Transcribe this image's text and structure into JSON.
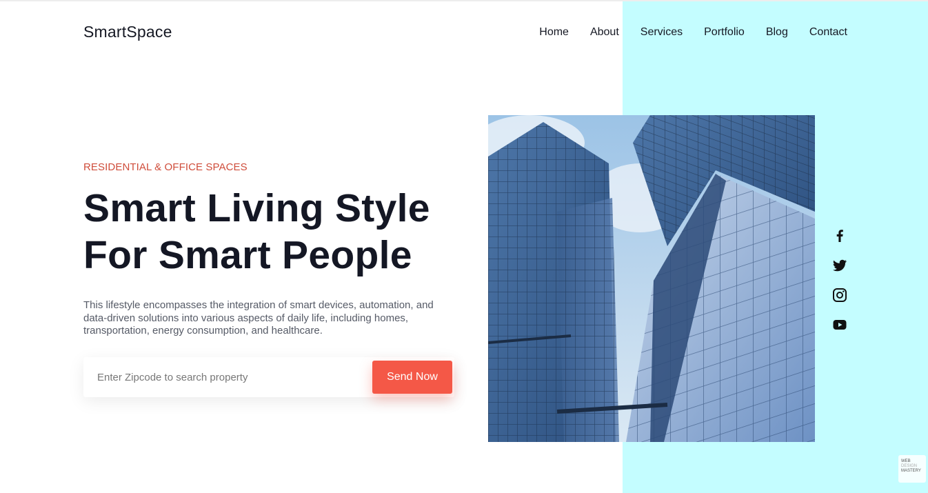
{
  "brand": {
    "name": "SmartSpace"
  },
  "nav": {
    "items": [
      "Home",
      "About",
      "Services",
      "Portfolio",
      "Blog",
      "Contact"
    ]
  },
  "hero": {
    "eyebrow": "RESIDENTIAL & OFFICE SPACES",
    "headline_line1": "Smart Living Style",
    "headline_line2": "For Smart People",
    "description": "This lifestyle encompasses the integration of smart devices, automation, and data-driven solutions into various aspects of daily life, including homes, transportation, energy consumption, and healthcare."
  },
  "search": {
    "placeholder": "Enter Zipcode to search property",
    "value": "",
    "button_label": "Send Now"
  },
  "social": [
    "facebook-icon",
    "twitter-icon",
    "instagram-icon",
    "youtube-icon"
  ],
  "watermark": {
    "line1": "WEB",
    "line2": "DESIGN",
    "line3": "MASTERY"
  },
  "colors": {
    "accent": "#f45847",
    "eyebrow": "#cf4c3a",
    "panel": "#c4fdff",
    "text": "#141724"
  }
}
